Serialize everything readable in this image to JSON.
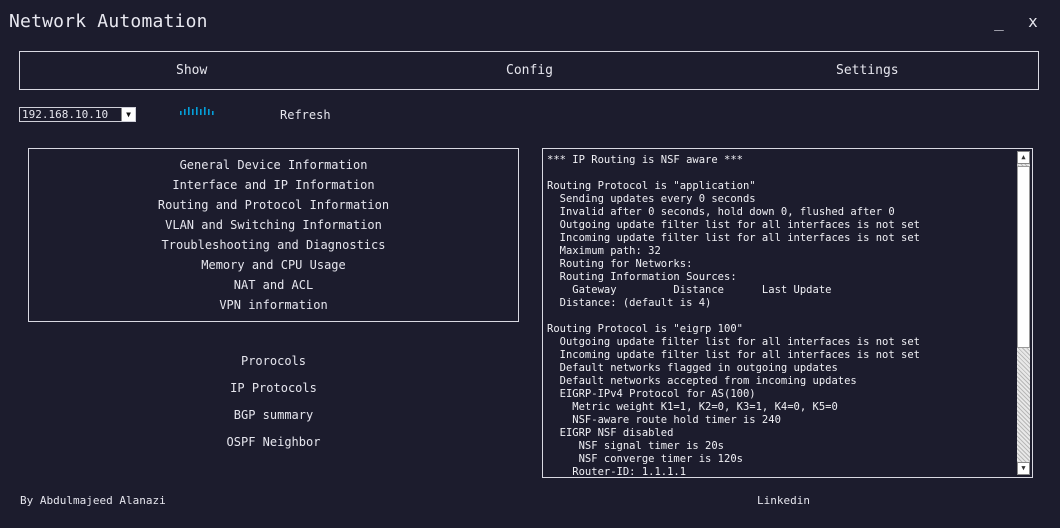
{
  "window": {
    "title": "Network Automation",
    "minimize": "_",
    "close": "x"
  },
  "menu": {
    "show": "Show",
    "config": "Config",
    "settings": "Settings"
  },
  "toolbar": {
    "ip_selected": "192.168.10.10",
    "refresh": "Refresh"
  },
  "nav": [
    "General Device Information",
    "Interface and IP Information",
    "Routing and Protocol Information",
    "VLAN and Switching Information",
    "Troubleshooting and Diagnostics",
    "Memory and CPU Usage",
    "NAT and ACL",
    "VPN information"
  ],
  "protocols": [
    "Prorocols",
    "IP Protocols",
    "BGP summary",
    "OSPF Neighbor"
  ],
  "output": "*** IP Routing is NSF aware ***\n\nRouting Protocol is \"application\"\n  Sending updates every 0 seconds\n  Invalid after 0 seconds, hold down 0, flushed after 0\n  Outgoing update filter list for all interfaces is not set\n  Incoming update filter list for all interfaces is not set\n  Maximum path: 32\n  Routing for Networks:\n  Routing Information Sources:\n    Gateway         Distance      Last Update\n  Distance: (default is 4)\n\nRouting Protocol is \"eigrp 100\"\n  Outgoing update filter list for all interfaces is not set\n  Incoming update filter list for all interfaces is not set\n  Default networks flagged in outgoing updates\n  Default networks accepted from incoming updates\n  EIGRP-IPv4 Protocol for AS(100)\n    Metric weight K1=1, K2=0, K3=1, K4=0, K5=0\n    NSF-aware route hold timer is 240\n  EIGRP NSF disabled\n     NSF signal timer is 20s\n     NSF converge timer is 120s\n    Router-ID: 1.1.1.1",
  "footer": {
    "author": "By Abdulmajeed Alanazi",
    "link": "Linkedin"
  },
  "colors": {
    "background": "#1c1c2d",
    "text": "#e6e6ee",
    "cisco_blue": "#049fd9"
  },
  "icons": {
    "logo": "cisco-logo-icon",
    "dropdown": "chevron-down-icon"
  }
}
